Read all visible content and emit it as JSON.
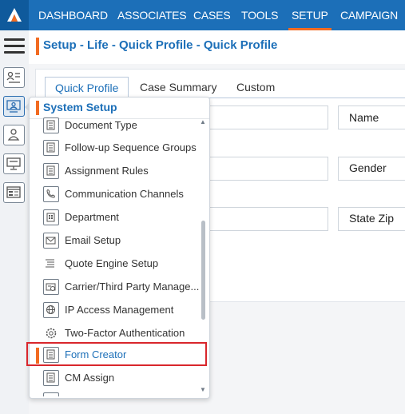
{
  "nav": {
    "items": [
      "DASHBOARD",
      "ASSOCIATES",
      "CASES",
      "TOOLS",
      "SETUP",
      "CAMPAIGN"
    ],
    "active": "SETUP"
  },
  "breadcrumb": "Setup - Life - Quick Profile - Quick Profile",
  "tabs": [
    "Quick Profile",
    "Case Summary",
    "Custom"
  ],
  "fields": {
    "name_label": "Name",
    "gender_label": "Gender",
    "state_zip_label": "State Zip"
  },
  "dropdown": {
    "title": "System Setup",
    "items": [
      {
        "label": "Document Type",
        "icon": "document-icon"
      },
      {
        "label": "Follow-up Sequence Groups",
        "icon": "document-icon"
      },
      {
        "label": "Assignment Rules",
        "icon": "document-icon"
      },
      {
        "label": "Communication Channels",
        "icon": "phone-icon"
      },
      {
        "label": "Department",
        "icon": "building-icon"
      },
      {
        "label": "Email Setup",
        "icon": "email-icon"
      },
      {
        "label": "Quote Engine Setup",
        "icon": "list-icon"
      },
      {
        "label": "Carrier/Third Party Manage...",
        "icon": "carrier-icon"
      },
      {
        "label": "IP Access Management",
        "icon": "globe-icon"
      },
      {
        "label": "Two-Factor Authentication",
        "icon": "gear-icon"
      },
      {
        "label": "Form Creator",
        "icon": "document-icon"
      },
      {
        "label": "CM Assign",
        "icon": "document-icon"
      }
    ],
    "selected": "Form Creator"
  },
  "colors": {
    "nav_bg": "#1c6fb8",
    "accent": "#f26b21",
    "highlight": "#d9262c"
  }
}
